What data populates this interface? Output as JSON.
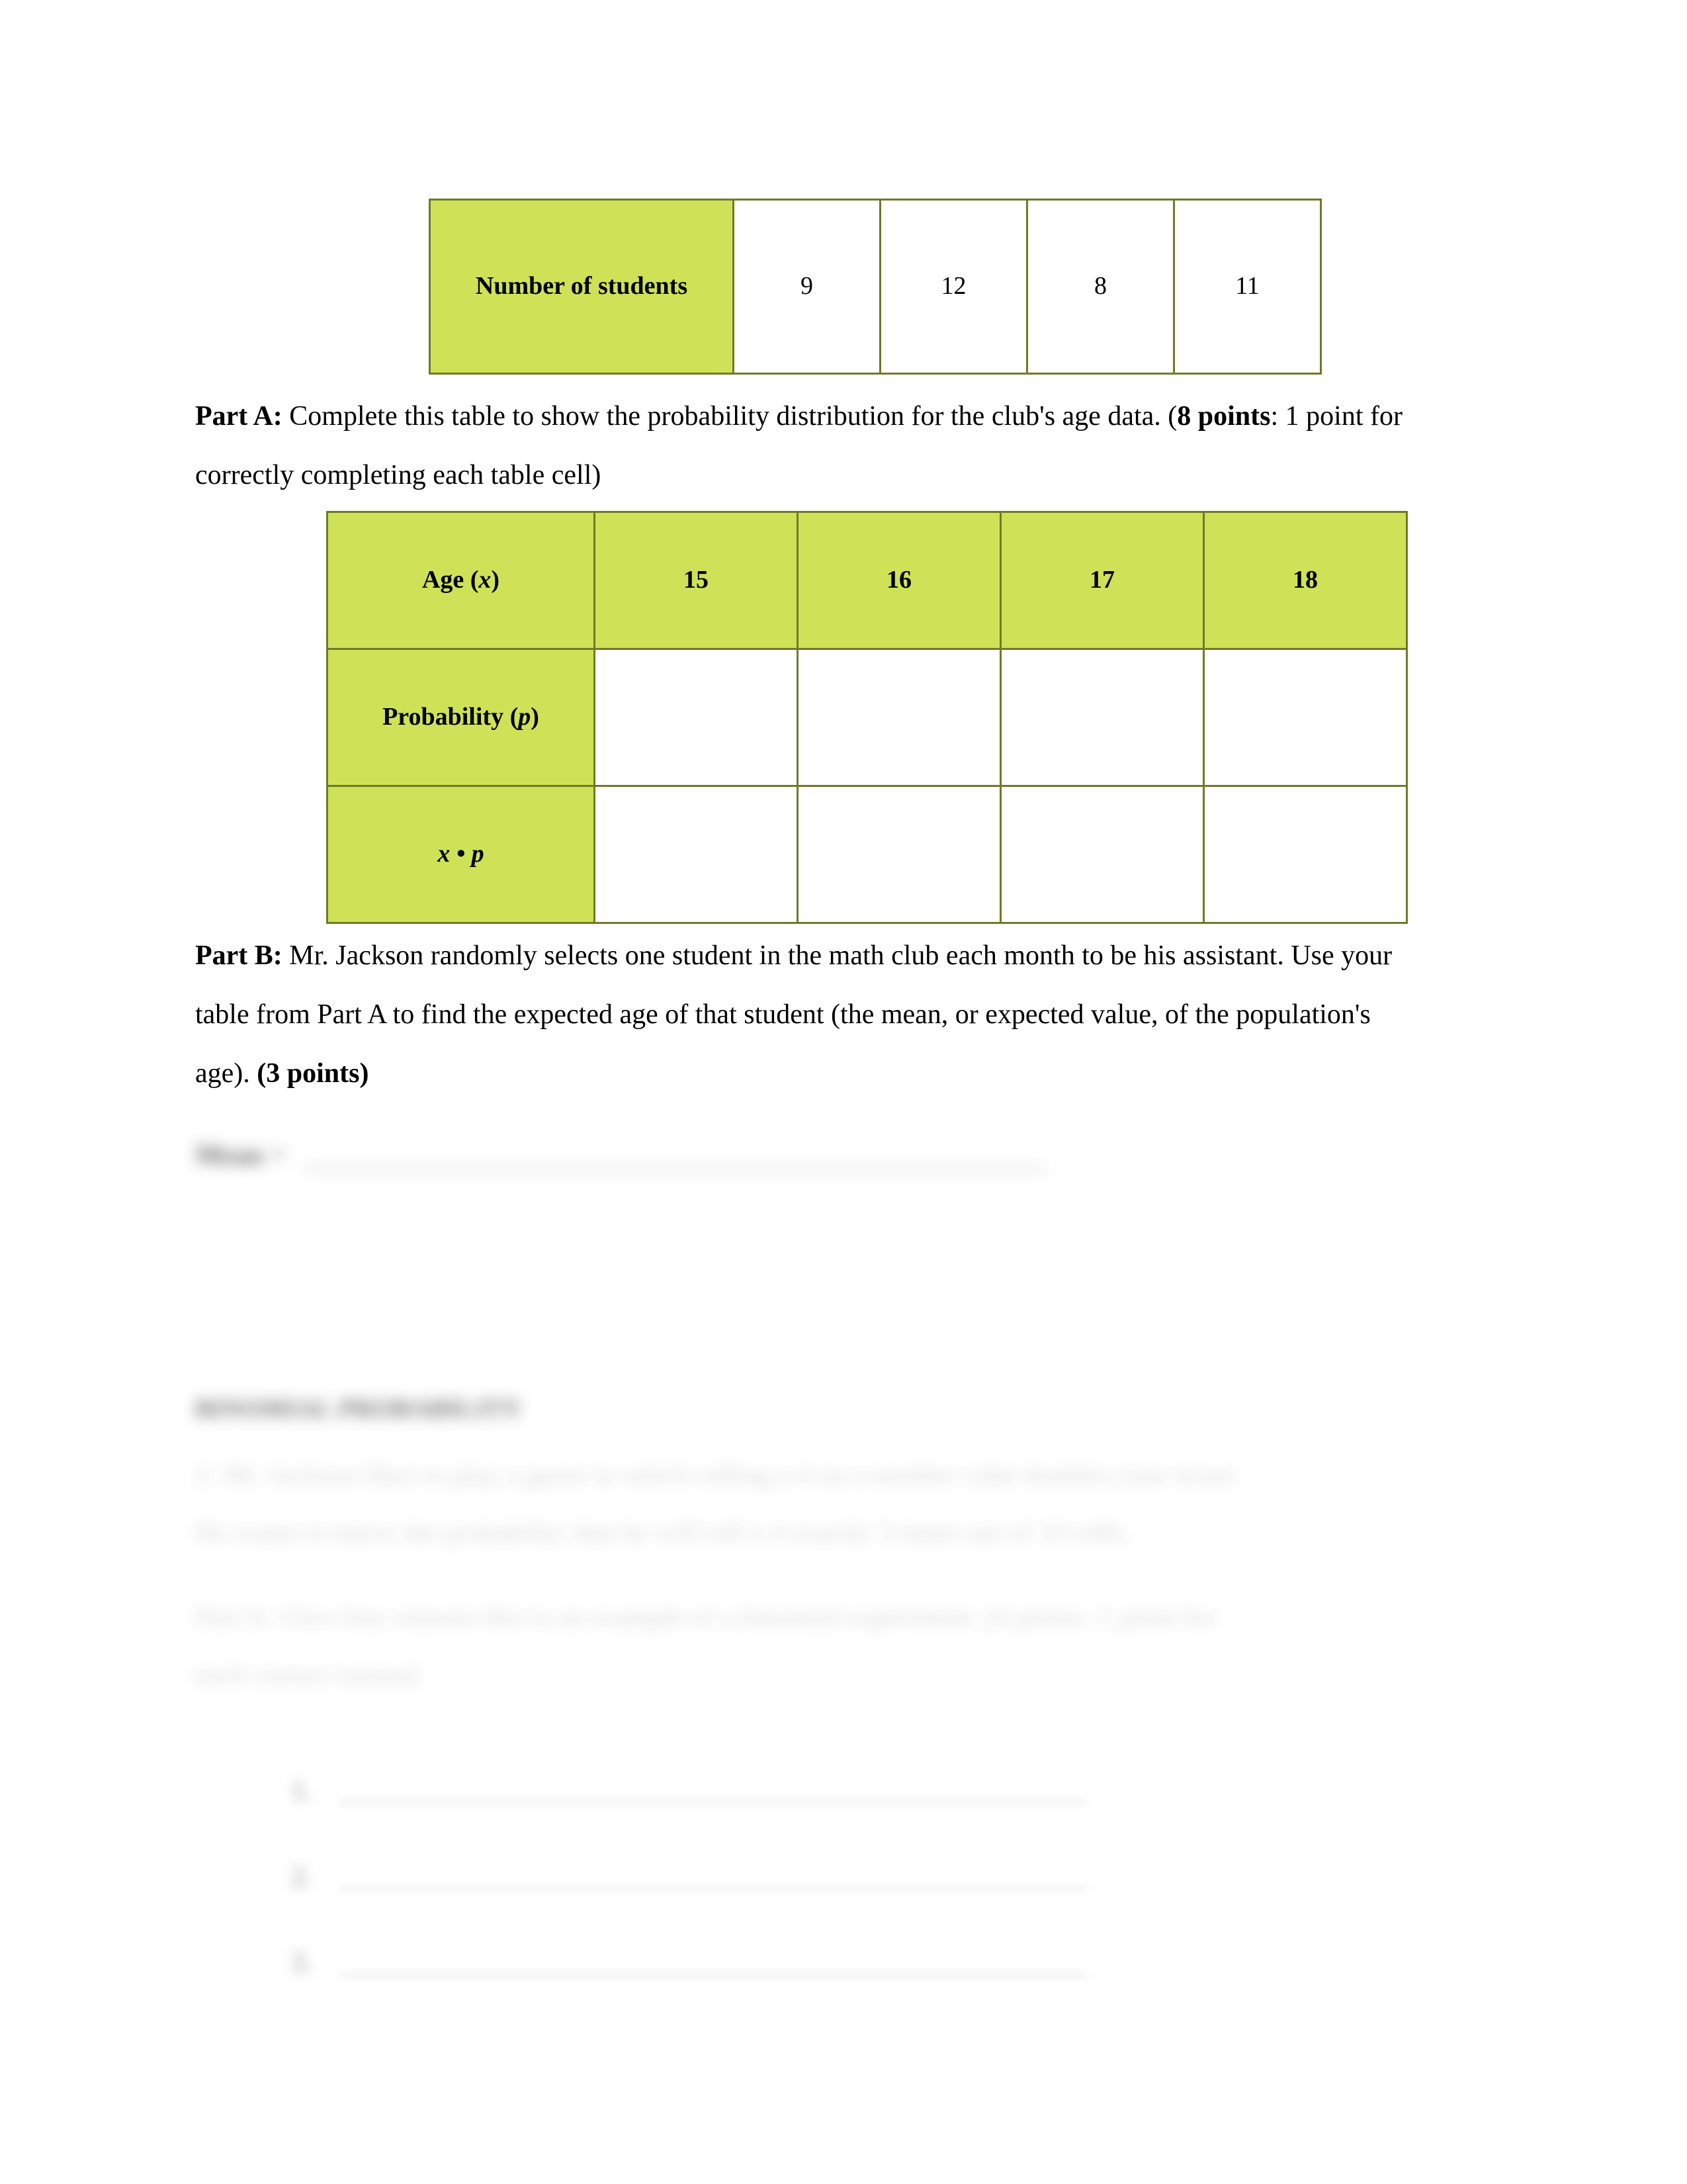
{
  "document": {
    "type": "math-worksheet",
    "background_color": "#ffffff",
    "table_header_color": "#CFE257",
    "table_border_color": "#6E7B26"
  },
  "students_table": {
    "row_label": "Number of students",
    "values": [
      "9",
      "12",
      "8",
      "11"
    ]
  },
  "part_a": {
    "label": "Part A:",
    "text_before_points": " Complete this table to show the probability distribution for the club's age data. (",
    "points": "8 points",
    "text_after_points": ": 1 point for correctly completing each table cell)"
  },
  "probability_table": {
    "header": {
      "label_prefix": "Age (",
      "label_var": "x",
      "label_suffix": ")",
      "ages": [
        "15",
        "16",
        "17",
        "18"
      ]
    },
    "rows": [
      {
        "label_prefix": "Probability (",
        "label_var": "p",
        "label_suffix": ")",
        "cells": [
          "",
          "",
          "",
          ""
        ]
      },
      {
        "label_prefix": "",
        "label_var": "x • p",
        "label_suffix": "",
        "cells": [
          "",
          "",
          "",
          ""
        ]
      }
    ]
  },
  "part_b": {
    "label": "Part B:",
    "text_before_points": " Mr. Jackson randomly selects one student in the math club each month to be his assistant. Use your table from Part A to find the expected age of that student (the mean, or expected value, of the population's age). ",
    "points": "(3 points)"
  },
  "redacted": {
    "answer_b_prefix": "Mean",
    "answer_b_equals": "=",
    "section_heading": "BINOMIAL PROBABILITY",
    "question_2_line_1": "2. Mr. Jackson likes to play a game in which rolling a 4 on a number cube doubles your score.",
    "question_2_line_2": "He wants to know the probability that he will roll a 4 exactly 3 times out of 10 rolls.",
    "sub_part_a_line_1": "Part A: Give four reasons this is an example of a binomial experiment. (4 points: 1 point for",
    "sub_part_a_line_2": "each correct reason)",
    "list_numbers": [
      "1.",
      "2.",
      "3."
    ]
  }
}
